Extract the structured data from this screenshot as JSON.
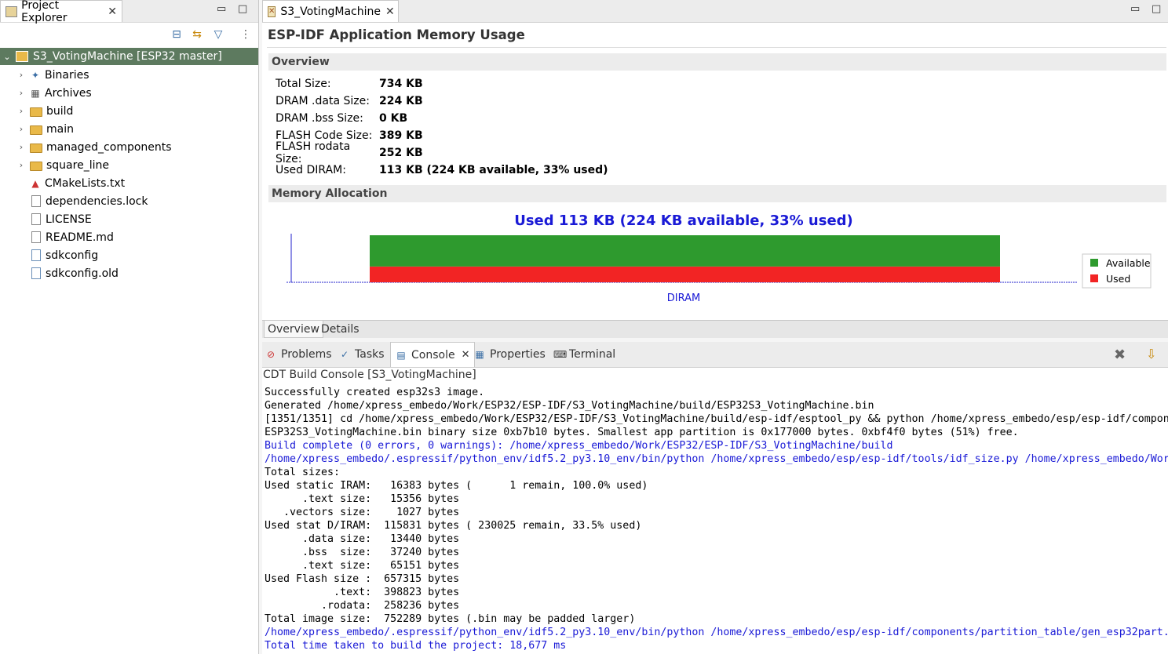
{
  "project_explorer": {
    "tab_label": "Project Explorer",
    "root": "S3_VotingMachine [ESP32 master]",
    "items": [
      {
        "label": "Binaries",
        "icon": "binaries-icon",
        "expandable": true
      },
      {
        "label": "Archives",
        "icon": "archives-icon",
        "expandable": true
      },
      {
        "label": "build",
        "icon": "folder-icon",
        "expandable": true
      },
      {
        "label": "main",
        "icon": "folder-icon",
        "expandable": true
      },
      {
        "label": "managed_components",
        "icon": "folder-icon",
        "expandable": true
      },
      {
        "label": "square_line",
        "icon": "folder-icon",
        "expandable": true
      },
      {
        "label": "CMakeLists.txt",
        "icon": "cmake-icon",
        "expandable": false
      },
      {
        "label": "dependencies.lock",
        "icon": "file-icon",
        "expandable": false
      },
      {
        "label": "LICENSE",
        "icon": "file-icon",
        "expandable": false
      },
      {
        "label": "README.md",
        "icon": "file-icon",
        "expandable": false
      },
      {
        "label": "sdkconfig",
        "icon": "config-file-icon",
        "expandable": false
      },
      {
        "label": "sdkconfig.old",
        "icon": "config-file-icon",
        "expandable": false
      }
    ]
  },
  "editor": {
    "tab_label": "S3_VotingMachine",
    "heading": "ESP-IDF Application Memory Usage",
    "overview_section": "Overview",
    "overview": [
      {
        "label": "Total Size:",
        "value": "734 KB"
      },
      {
        "label": "DRAM .data Size:",
        "value": "224 KB"
      },
      {
        "label": "DRAM .bss Size:",
        "value": "0 KB"
      },
      {
        "label": "FLASH Code Size:",
        "value": "389 KB"
      },
      {
        "label": "FLASH rodata Size:",
        "value": "252 KB"
      },
      {
        "label": "Used DIRAM:",
        "value": "113 KB (224 KB available, 33%  used)"
      }
    ],
    "allocation_section": "Memory Allocation",
    "bottom_tabs": [
      "Overview",
      "Details"
    ]
  },
  "chart_data": {
    "type": "bar",
    "title": "Used 113 KB (224 KB available, 33%  used)",
    "categories": [
      "DIRAM"
    ],
    "series": [
      {
        "name": "Used",
        "values": [
          113
        ],
        "color": "#f22424"
      },
      {
        "name": "Available",
        "values": [
          224
        ],
        "color": "#2e9a2e"
      }
    ],
    "stacked": true,
    "legend_position": "right",
    "title_color": "#1a1ad6",
    "xlabel": "",
    "ylabel": ""
  },
  "console": {
    "tabs": [
      "Problems",
      "Tasks",
      "Console",
      "Properties",
      "Terminal"
    ],
    "title": "CDT Build Console [S3_VotingMachine]",
    "lines": [
      {
        "text": "Successfully created esp32s3 image.",
        "color": "black"
      },
      {
        "text": "Generated /home/xpress_embedo/Work/ESP32/ESP-IDF/S3_VotingMachine/build/ESP32S3_VotingMachine.bin",
        "color": "black"
      },
      {
        "text": "[1351/1351] cd /home/xpress_embedo/Work/ESP32/ESP-IDF/S3_VotingMachine/build/esp-idf/esptool_py && python /home/xpress_embedo/esp/esp-idf/compon",
        "color": "black"
      },
      {
        "text": "ESP32S3_VotingMachine.bin binary size 0xb7b10 bytes. Smallest app partition is 0x177000 bytes. 0xbf4f0 bytes (51%) free.",
        "color": "black"
      },
      {
        "text": "Build complete (0 errors, 0 warnings): /home/xpress_embedo/Work/ESP32/ESP-IDF/S3_VotingMachine/build",
        "color": "blue"
      },
      {
        "text": "/home/xpress_embedo/.espressif/python_env/idf5.2_py3.10_env/bin/python /home/xpress_embedo/esp/esp-idf/tools/idf_size.py /home/xpress_embedo/Wor",
        "color": "blue"
      },
      {
        "text": "Total sizes:",
        "color": "black"
      },
      {
        "text": "Used static IRAM:   16383 bytes (      1 remain, 100.0% used)",
        "color": "black"
      },
      {
        "text": "      .text size:   15356 bytes",
        "color": "black"
      },
      {
        "text": "   .vectors size:    1027 bytes",
        "color": "black"
      },
      {
        "text": "Used stat D/IRAM:  115831 bytes ( 230025 remain, 33.5% used)",
        "color": "black"
      },
      {
        "text": "      .data size:   13440 bytes",
        "color": "black"
      },
      {
        "text": "      .bss  size:   37240 bytes",
        "color": "black"
      },
      {
        "text": "      .text size:   65151 bytes",
        "color": "black"
      },
      {
        "text": "Used Flash size :  657315 bytes",
        "color": "black"
      },
      {
        "text": "           .text:  398823 bytes",
        "color": "black"
      },
      {
        "text": "         .rodata:  258236 bytes",
        "color": "black"
      },
      {
        "text": "Total image size:  752289 bytes (.bin may be padded larger)",
        "color": "black"
      },
      {
        "text": "/home/xpress_embedo/.espressif/python_env/idf5.2_py3.10_env/bin/python /home/xpress_embedo/esp/esp-idf/components/partition_table/gen_esp32part.",
        "color": "blue"
      },
      {
        "text": "Total time taken to build the project: 18,677 ms",
        "color": "blue"
      }
    ]
  }
}
